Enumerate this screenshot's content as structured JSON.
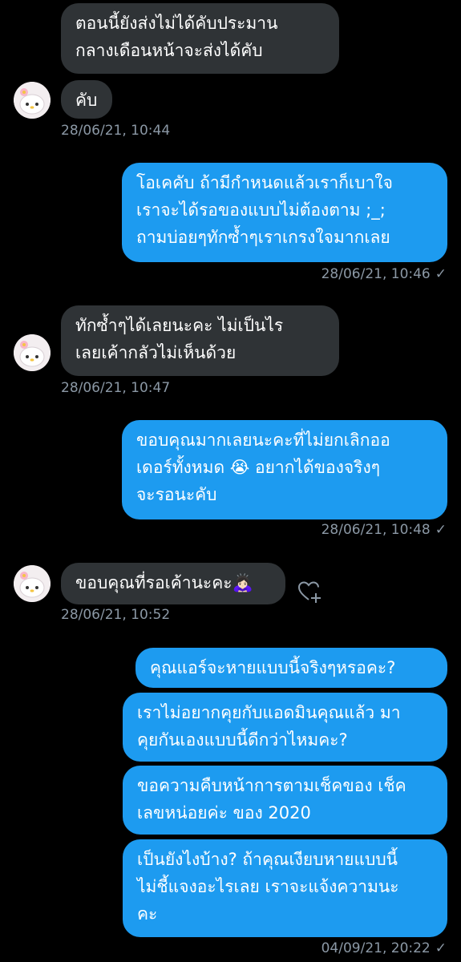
{
  "messages": [
    {
      "from": "them",
      "text": "ตอนนี้ยังส่งไม่ได้คับประมาน\nกลางเดือนหน้าจะส่งได้คับ"
    },
    {
      "from": "them",
      "text": "คับ",
      "time": "28/06/21, 10:44"
    },
    {
      "from": "me",
      "text": "โอเคคับ ถ้ามีกำหนดแล้วเราก็เบาใจ\nเราจะได้รอของแบบไม่ต้องตาม ;_;\nถามบ่อยๆทักซ้ำๆเราเกรงใจมากเลย",
      "time": "28/06/21, 10:46"
    },
    {
      "from": "them",
      "text": "ทักซ้ำๆได้เลยนะคะ ไม่เป็นไร\nเลยเค้ากลัวไม่เห็นด้วย",
      "time": "28/06/21, 10:47"
    },
    {
      "from": "me",
      "text": "ขอบคุณมากเลยนะคะที่ไม่ยกเลิกออ\nเดอร์ทั้งหมด 😭 อยากได้ของจริงๆ\nจะรอนะคับ",
      "time": "28/06/21, 10:48"
    },
    {
      "from": "them",
      "text": "ขอบคุณที่รอเค้านะคะ🙇🏻‍♀️",
      "time": "28/06/21, 10:52"
    },
    {
      "from": "me",
      "text": "คุณแอร์จะหายแบบนี้จริงๆหรอคะ?"
    },
    {
      "from": "me",
      "text": "เราไม่อยากคุยกับแอดมินคุณแล้ว มา\nคุยกันเองแบบนี้ดีกว่าไหมคะ?"
    },
    {
      "from": "me",
      "text": "ขอความคืบหน้าการตามเช็คของ เช็ค\nเลขหน่อยค่ะ ของ 2020"
    },
    {
      "from": "me",
      "text": "เป็นยังไงบ้าง? ถ้าคุณเงียบหายแบบนี้\nไม่ชี้แจงอะไรเลย เราจะแจ้งความนะ\nคะ",
      "time": "04/09/21, 20:22"
    }
  ],
  "status": {
    "sent_mark": "✓"
  },
  "colors": {
    "incoming": "#2f3336",
    "outgoing": "#1d9bf0",
    "timestamp": "#8b98a5"
  },
  "icons": {
    "avatar": "my-melody-avatar",
    "reaction": "heart-plus-icon"
  }
}
